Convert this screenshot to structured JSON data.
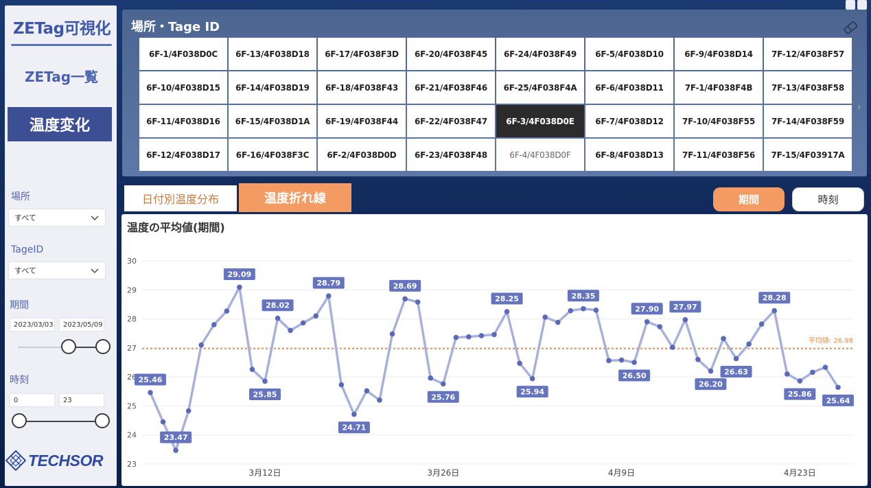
{
  "sidebar": {
    "app_title": "ZETag可視化",
    "nav_list": "ZETag一覧",
    "nav_active": "温度変化",
    "filters": {
      "location_label": "場所",
      "location_value": "すべて",
      "tageid_label": "TageID",
      "tageid_value": "すべて",
      "period_label": "期間",
      "period_start": "2023/03/03",
      "period_end": "2023/05/09",
      "period_range": [
        0.6,
        1.0
      ],
      "time_label": "時刻",
      "time_start": "0",
      "time_end": "23",
      "time_range": [
        0.0,
        1.0
      ]
    },
    "brand": "TECHSOR"
  },
  "slicer": {
    "title": "場所・Tage ID",
    "selected": "6F-3/4F038D0E",
    "dimmed": "6F-4/4F038D0F",
    "tags": [
      "6F-1/4F038D0C",
      "6F-13/4F038D18",
      "6F-17/4F038F3D",
      "6F-20/4F038F45",
      "6F-24/4F038F49",
      "6F-5/4F038D10",
      "6F-9/4F038D14",
      "7F-12/4F038F57",
      "6F-10/4F038D15",
      "6F-14/4F038D19",
      "6F-18/4F038F43",
      "6F-21/4F038F46",
      "6F-25/4F038F4A",
      "6F-6/4F038D11",
      "7F-1/4F038F4B",
      "7F-13/4F038F58",
      "6F-11/4F038D16",
      "6F-15/4F038D1A",
      "6F-19/4F038F44",
      "6F-22/4F038F47",
      "6F-3/4F038D0E",
      "6F-7/4F038D12",
      "7F-10/4F038F55",
      "7F-14/4F038F59",
      "6F-12/4F038D17",
      "6F-16/4F038F3C",
      "6F-2/4F038D0D",
      "6F-23/4F038F48",
      "6F-4/4F038D0F",
      "6F-8/4F038D13",
      "7F-11/4F038F56",
      "7F-15/4F03917A"
    ]
  },
  "tabs": {
    "inactive_label": "日付別温度分布",
    "active_label": "温度折れ線"
  },
  "buttons": {
    "period": "期間",
    "time": "時刻"
  },
  "colors": {
    "accent_orange": "#f39b62",
    "line": "#a7b1db",
    "point": "#5a69b8",
    "label_bg": "#6574bf",
    "avg_line": "#f08a3c"
  },
  "chart_data": {
    "type": "line",
    "title": "温度の平均値(期間)",
    "ylim": [
      23,
      30
    ],
    "yticks": [
      23,
      24,
      25,
      26,
      27,
      28,
      29,
      30
    ],
    "x_tick_labels": [
      {
        "label": "3月12日",
        "index": 9
      },
      {
        "label": "3月26日",
        "index": 23
      },
      {
        "label": "4月9日",
        "index": 37
      },
      {
        "label": "4月23日",
        "index": 51
      }
    ],
    "values": [
      25.46,
      24.45,
      23.47,
      24.83,
      27.1,
      27.8,
      28.27,
      29.09,
      26.26,
      25.85,
      28.02,
      27.6,
      27.86,
      28.1,
      28.79,
      25.73,
      24.71,
      25.52,
      25.2,
      27.48,
      28.69,
      28.58,
      25.96,
      25.76,
      27.36,
      27.38,
      27.42,
      27.46,
      28.25,
      26.47,
      25.94,
      28.06,
      27.88,
      28.28,
      28.35,
      28.3,
      26.56,
      26.58,
      26.5,
      27.9,
      27.73,
      27.02,
      27.97,
      26.6,
      26.2,
      27.32,
      26.63,
      27.13,
      27.82,
      28.28,
      26.1,
      25.86,
      26.16,
      26.33,
      25.64
    ],
    "labeled_points": [
      {
        "index": 0,
        "label": "25.46",
        "pos": "above"
      },
      {
        "index": 2,
        "label": "23.47",
        "pos": "above"
      },
      {
        "index": 7,
        "label": "29.09",
        "pos": "above"
      },
      {
        "index": 9,
        "label": "25.85",
        "pos": "below"
      },
      {
        "index": 10,
        "label": "28.02",
        "pos": "above"
      },
      {
        "index": 14,
        "label": "28.79",
        "pos": "above"
      },
      {
        "index": 16,
        "label": "24.71",
        "pos": "below"
      },
      {
        "index": 20,
        "label": "28.69",
        "pos": "above"
      },
      {
        "index": 23,
        "label": "25.76",
        "pos": "below"
      },
      {
        "index": 28,
        "label": "28.25",
        "pos": "above"
      },
      {
        "index": 30,
        "label": "25.94",
        "pos": "below"
      },
      {
        "index": 34,
        "label": "28.35",
        "pos": "above"
      },
      {
        "index": 38,
        "label": "26.50",
        "pos": "below"
      },
      {
        "index": 39,
        "label": "27.90",
        "pos": "above"
      },
      {
        "index": 42,
        "label": "27.97",
        "pos": "above"
      },
      {
        "index": 44,
        "label": "26.20",
        "pos": "below"
      },
      {
        "index": 46,
        "label": "26.63",
        "pos": "below"
      },
      {
        "index": 49,
        "label": "28.28",
        "pos": "above"
      },
      {
        "index": 51,
        "label": "25.86",
        "pos": "below"
      },
      {
        "index": 54,
        "label": "25.64",
        "pos": "below"
      }
    ],
    "average": {
      "value": 26.98,
      "label": "平均値: 26.98"
    },
    "grid": true
  }
}
